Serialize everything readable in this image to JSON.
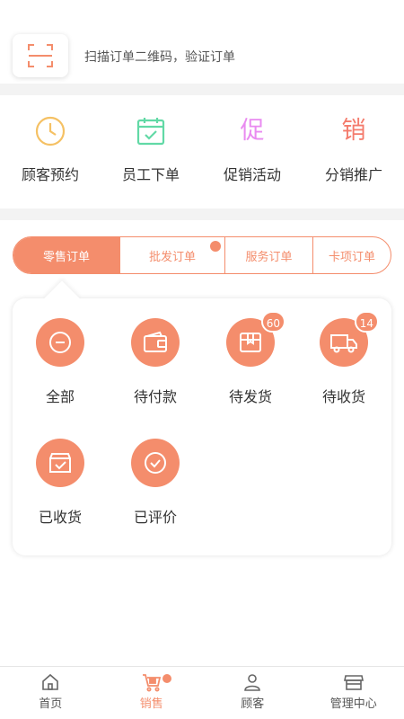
{
  "scan": {
    "hint": "扫描订单二维码，验证订单"
  },
  "quick_actions": [
    {
      "label": "顾客预约",
      "icon": "clock-icon",
      "color": "#f5c164"
    },
    {
      "label": "员工下单",
      "icon": "calendar-check-icon",
      "color": "#62d9a6"
    },
    {
      "label": "促销活动",
      "icon_char": "促",
      "color": "#e98bf0"
    },
    {
      "label": "分销推广",
      "icon_char": "销",
      "color": "#f47b6c"
    }
  ],
  "tabs": [
    {
      "label": "零售订单",
      "active": true
    },
    {
      "label": "批发订单",
      "has_dot": true
    },
    {
      "label": "服务订单"
    },
    {
      "label": "卡项订单"
    }
  ],
  "orders": [
    {
      "label": "全部",
      "icon": "minus-circle-icon"
    },
    {
      "label": "待付款",
      "icon": "wallet-icon"
    },
    {
      "label": "待发货",
      "icon": "box-icon",
      "badge": "60"
    },
    {
      "label": "待收货",
      "icon": "truck-icon",
      "badge": "14"
    },
    {
      "label": "已收货",
      "icon": "received-box-icon"
    },
    {
      "label": "已评价",
      "icon": "check-circle-icon"
    }
  ],
  "bottom_nav": [
    {
      "label": "首页",
      "icon": "home-icon"
    },
    {
      "label": "销售",
      "icon": "cart-icon",
      "active": true,
      "has_dot": true
    },
    {
      "label": "顾客",
      "icon": "users-icon"
    },
    {
      "label": "管理中心",
      "icon": "store-icon"
    }
  ],
  "colors": {
    "accent": "#f48d6c"
  }
}
